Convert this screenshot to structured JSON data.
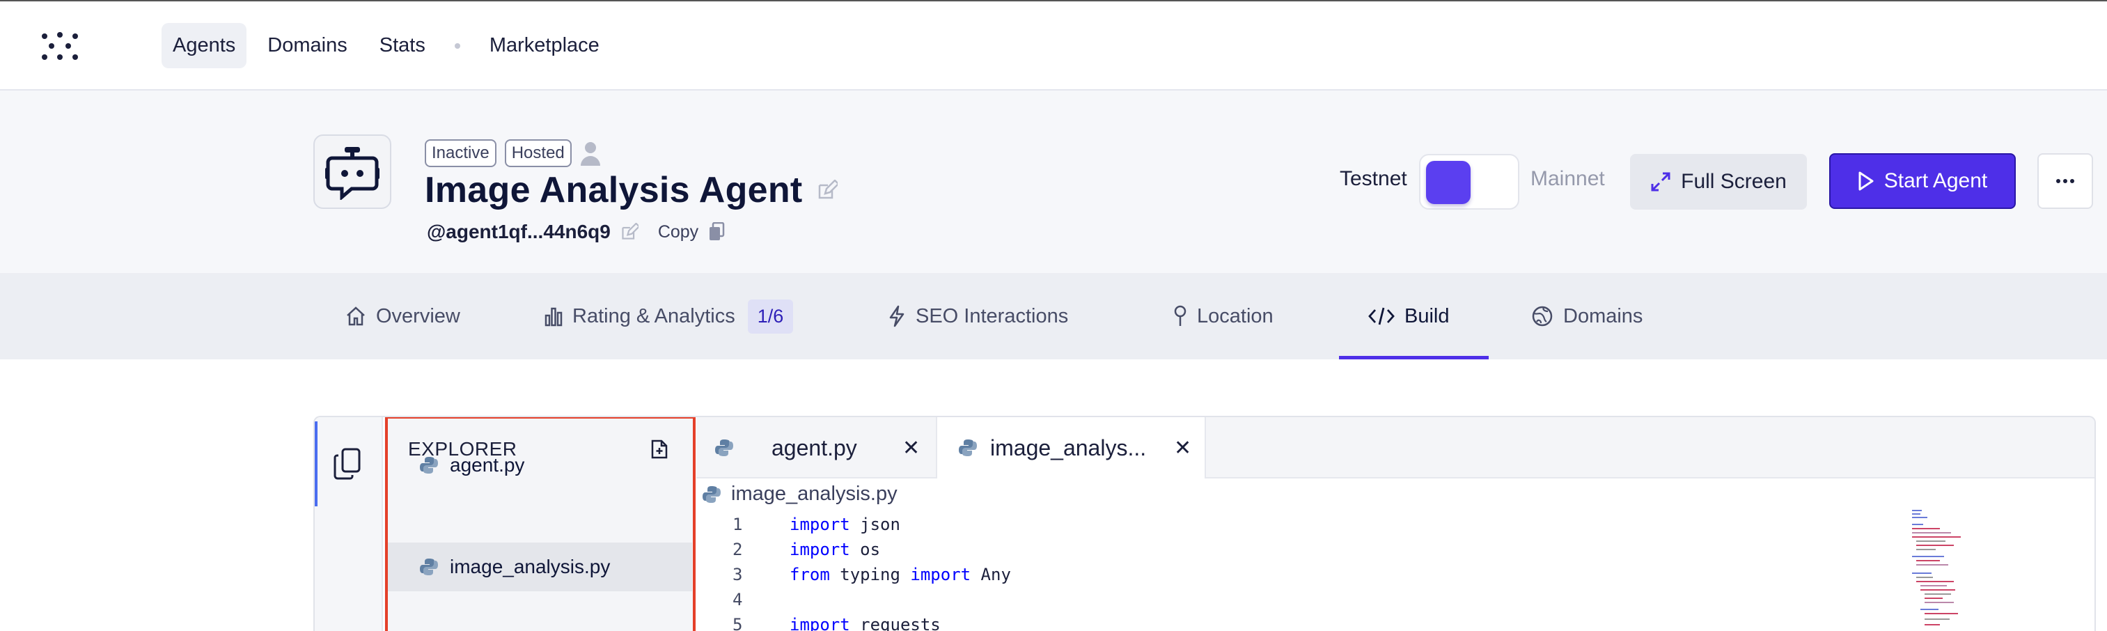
{
  "nav": {
    "links": [
      "Agents",
      "Domains",
      "Stats",
      "Marketplace"
    ],
    "active": "Agents"
  },
  "agent": {
    "badges": [
      "Inactive",
      "Hosted"
    ],
    "title": "Image Analysis Agent",
    "address": "@agent1qf...44n6q9",
    "copy_label": "Copy",
    "network": {
      "left": "Testnet",
      "right": "Mainnet",
      "selected": "Testnet"
    },
    "buttons": {
      "full_screen": "Full Screen",
      "start": "Start Agent"
    }
  },
  "tabs": {
    "items": [
      "Overview",
      "Rating & Analytics",
      "SEO Interactions",
      "Location",
      "Build",
      "Domains"
    ],
    "analytics_count": "1/6",
    "active": "Build"
  },
  "ide": {
    "explorer_title": "EXPLORER",
    "files": [
      "agent.py",
      "image_analysis.py"
    ],
    "selected_file": "image_analysis.py",
    "editor_tabs": [
      "agent.py",
      "image_analys..."
    ],
    "active_editor_tab": "image_analys...",
    "breadcrumb": "image_analysis.py",
    "code_lines": [
      {
        "n": "1",
        "kw1": "import",
        "rest": " json"
      },
      {
        "n": "2",
        "kw1": "import",
        "rest": " os"
      },
      {
        "n": "3",
        "kw1": "from",
        "mid": " typing ",
        "kw2": "import",
        "rest": " Any"
      },
      {
        "n": "4"
      },
      {
        "n": "5",
        "kw1": "import",
        "rest": " requests"
      }
    ]
  },
  "colors": {
    "accent": "#4e2fe8",
    "highlight_frame": "#e4402a"
  },
  "icons": [
    "logo-icon",
    "robot-icon",
    "user-icon",
    "edit-icon",
    "copy-icon",
    "expand-icon",
    "play-icon",
    "more-icon",
    "home-icon",
    "bar-chart-icon",
    "bolt-icon",
    "pin-icon",
    "code-icon",
    "globe-icon",
    "files-icon",
    "new-file-icon",
    "python-icon",
    "close-icon"
  ]
}
